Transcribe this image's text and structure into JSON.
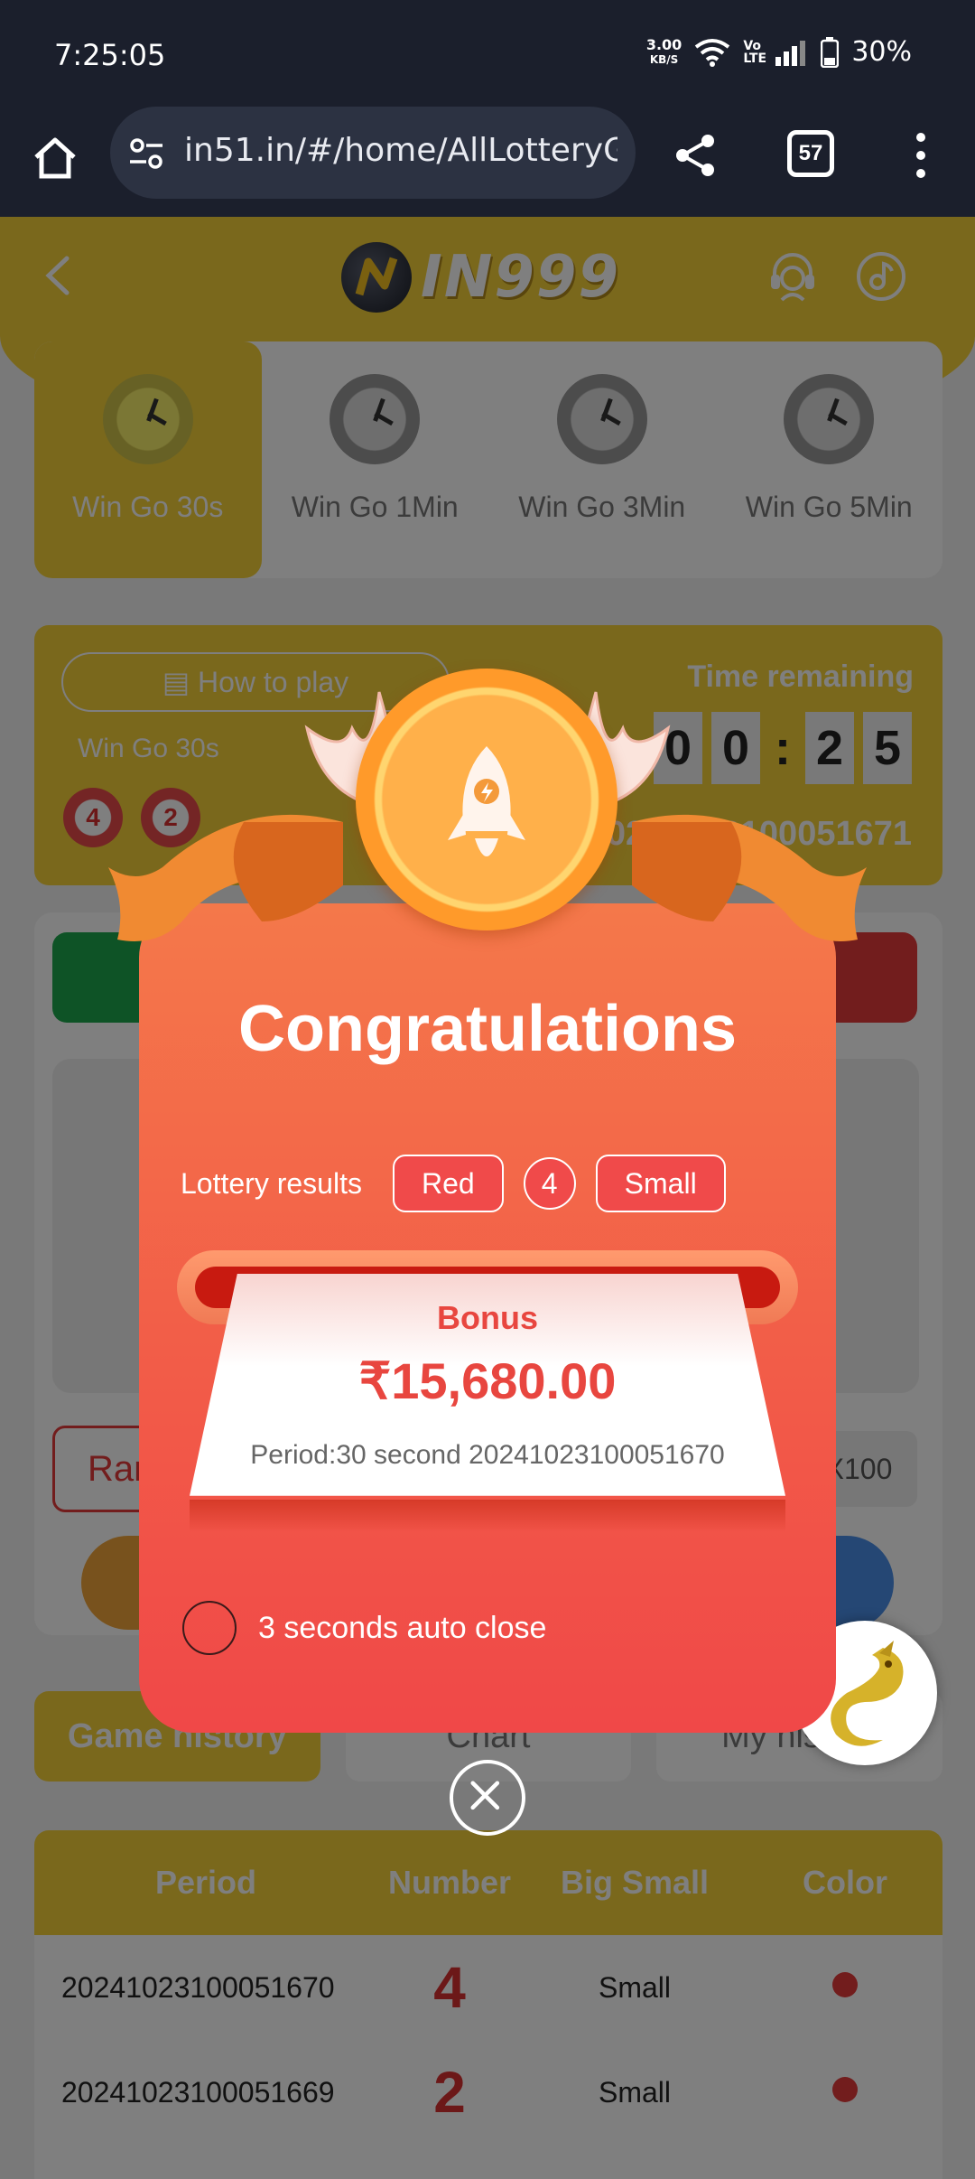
{
  "status_bar": {
    "time": "7:25:05",
    "net_speed": "3.00",
    "net_unit": "KB/S",
    "volte": "Vo LTE",
    "battery": "30%"
  },
  "browser": {
    "url": "in51.in/#/home/AllLotteryGames",
    "tab_count": "57"
  },
  "header": {
    "logo_text": "IN999"
  },
  "game_tabs": [
    {
      "label": "Win Go 30s",
      "active": true
    },
    {
      "label": "Win Go 1Min",
      "active": false
    },
    {
      "label": "Win Go 3Min",
      "active": false
    },
    {
      "label": "Win Go 5Min",
      "active": false
    }
  ],
  "info": {
    "how_to_play": "How to play",
    "game_name": "Win Go 30s",
    "balls": [
      "4",
      "2"
    ],
    "time_remaining_label": "Time remaining",
    "digits": [
      "0",
      "0",
      ":",
      "2",
      "5"
    ],
    "period_number": "20241023100051671"
  },
  "bet": {
    "random_label": "Random",
    "multiplier_label": "X100"
  },
  "history_tabs": [
    "Game history",
    "Chart",
    "My history"
  ],
  "history_table": {
    "headers": [
      "Period",
      "Number",
      "Big Small",
      "Color"
    ],
    "rows": [
      {
        "period": "20241023100051670",
        "number": "4",
        "size": "Small",
        "color": "red"
      },
      {
        "period": "20241023100051669",
        "number": "2",
        "size": "Small",
        "color": "red"
      }
    ]
  },
  "modal": {
    "title": "Congratulations",
    "results_label": "Lottery results",
    "result_color": "Red",
    "result_number": "4",
    "result_size": "Small",
    "bonus_label": "Bonus",
    "bonus_amount": "₹15,680.00",
    "period_text": "Period:30 second 20241023100051670",
    "auto_close": "3 seconds auto close"
  },
  "colors": {
    "brand_yellow": "#f4d039",
    "modal_red": "#f25a48",
    "result_red": "#e43b3b"
  }
}
